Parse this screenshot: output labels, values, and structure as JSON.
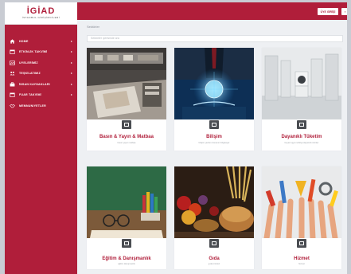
{
  "brand": {
    "logo_text": "İGİAD",
    "logo_subtext": "İSTANBUL GİRİŞİMCİLERİ"
  },
  "sidebar": {
    "items": [
      {
        "label": "HOME",
        "icon": "home-icon"
      },
      {
        "label": "ETKİNLİK TAKVİMİ",
        "icon": "calendar-icon"
      },
      {
        "label": "ÜYELERİMİZ",
        "icon": "users-icon"
      },
      {
        "label": "TEŞKİLATIMIZ",
        "icon": "organization-icon"
      },
      {
        "label": "İNSAN KAYNAKLARI",
        "icon": "briefcase-icon"
      },
      {
        "label": "FUAR TAKVİMİ",
        "icon": "calendar-icon"
      },
      {
        "label": "MEMNUNIYETLER",
        "icon": "handshake-icon"
      }
    ]
  },
  "header": {
    "login_label": "ÜYE GİRİŞİ",
    "menu_label": "≡"
  },
  "breadcrumb": "Sektörler",
  "search": {
    "placeholder": "Sektörler içerisinde ara"
  },
  "cards": [
    {
      "title": "Basın & Yayın & Matbaa",
      "subtitle": "basın yayın matbaa",
      "icon": "printing-press-image"
    },
    {
      "title": "Bilişim",
      "subtitle": "bilişim yazılım donanım bilgisayar",
      "icon": "technology-image"
    },
    {
      "title": "Dayanıklı Tüketim",
      "subtitle": "beyaz eşya mobilya dayanıklı ürünler",
      "icon": "appliances-image"
    },
    {
      "title": "Eğitim & Danışmanlık",
      "subtitle": "eğitim danışmanlık",
      "icon": "education-image"
    },
    {
      "title": "Gıda",
      "subtitle": "gıda ürünleri",
      "icon": "food-image"
    },
    {
      "title": "Hizmet",
      "subtitle": "hizmet",
      "icon": "tools-image"
    }
  ],
  "colors": {
    "brand": "#b01e3a",
    "badge": "#4a4d52",
    "page_bg": "#eef0f3"
  }
}
